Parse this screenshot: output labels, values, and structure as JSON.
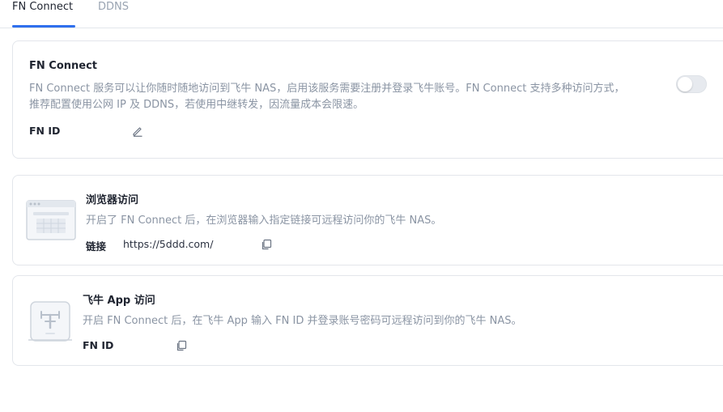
{
  "tabs": [
    {
      "label": "FN Connect",
      "active": true
    },
    {
      "label": "DDNS",
      "active": false
    }
  ],
  "fn_connect": {
    "title": "FN Connect",
    "desc_line1": "FN Connect 服务可以让你随时随地访问到飞牛 NAS，启用该服务需要注册并登录飞牛账号。FN Connect 支持多种访问方式，",
    "desc_line2": "推荐配置使用公网 IP 及 DDNS，若使用中继转发，因流量成本会限速。",
    "fn_id_label": "FN ID",
    "enabled": false,
    "icons": {
      "edit": "edit-pencil-icon"
    }
  },
  "browser_access": {
    "title": "浏览器访问",
    "desc": "开启了 FN Connect 后，在浏览器输入指定链接可远程访问你的飞牛 NAS。",
    "link_label": "链接",
    "link_value": "https://5ddd.com/",
    "icons": {
      "illustration": "browser-window-icon",
      "copy": "copy-icon"
    }
  },
  "app_access": {
    "title": "飞牛 App 访问",
    "desc": "开启 FN Connect 后，在飞牛 App 输入 FN ID 并登录账号密码可远程访问到你的飞牛 NAS。",
    "fn_id_label": "FN ID",
    "icons": {
      "illustration": "mobile-app-icon",
      "copy": "copy-icon"
    }
  },
  "colors": {
    "accent": "#2f6fed",
    "border": "#e3e6eb",
    "muted_text": "#8a94a3",
    "toggle_off": "#e7eaef"
  }
}
